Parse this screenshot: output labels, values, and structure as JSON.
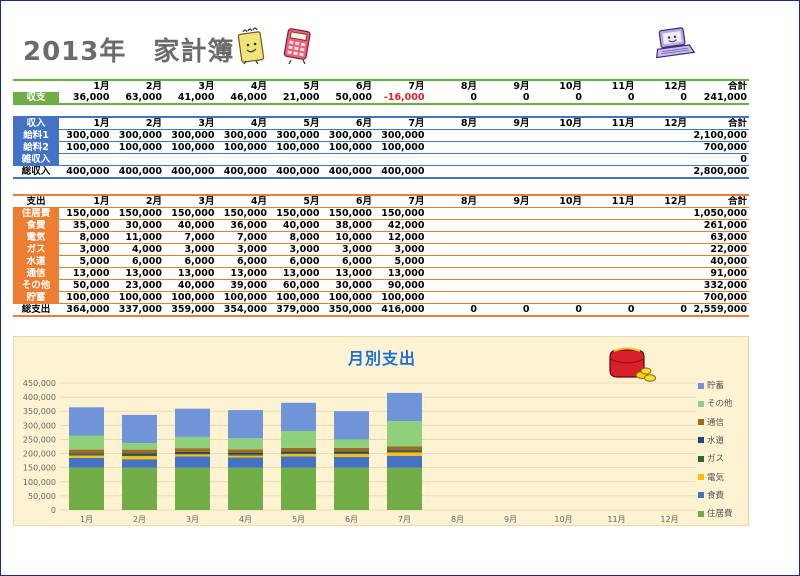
{
  "title": "2013年　家計簿",
  "months": [
    "1月",
    "2月",
    "3月",
    "4月",
    "5月",
    "6月",
    "7月",
    "8月",
    "9月",
    "10月",
    "11月",
    "12月"
  ],
  "total_label": "合計",
  "balance": {
    "label": "収支",
    "values": [
      "36,000",
      "63,000",
      "41,000",
      "46,000",
      "21,000",
      "50,000",
      "-16,000",
      "0",
      "0",
      "0",
      "0",
      "0"
    ],
    "total": "241,000"
  },
  "income": {
    "header": "収入",
    "rows": [
      {
        "label": "給料1",
        "values": [
          "300,000",
          "300,000",
          "300,000",
          "300,000",
          "300,000",
          "300,000",
          "300,000",
          "",
          "",
          "",
          "",
          ""
        ],
        "total": "2,100,000"
      },
      {
        "label": "給料2",
        "values": [
          "100,000",
          "100,000",
          "100,000",
          "100,000",
          "100,000",
          "100,000",
          "100,000",
          "",
          "",
          "",
          "",
          ""
        ],
        "total": "700,000"
      },
      {
        "label": "雑収入",
        "values": [
          "",
          "",
          "",
          "",
          "",
          "",
          "",
          "",
          "",
          "",
          "",
          ""
        ],
        "total": "0"
      }
    ],
    "sum": {
      "label": "総収入",
      "values": [
        "400,000",
        "400,000",
        "400,000",
        "400,000",
        "400,000",
        "400,000",
        "400,000",
        "",
        "",
        "",
        "",
        ""
      ],
      "total": "2,800,000"
    }
  },
  "expense": {
    "header": "支出",
    "rows": [
      {
        "label": "住居費",
        "values": [
          "150,000",
          "150,000",
          "150,000",
          "150,000",
          "150,000",
          "150,000",
          "150,000",
          "",
          "",
          "",
          "",
          ""
        ],
        "total": "1,050,000"
      },
      {
        "label": "食費",
        "values": [
          "35,000",
          "30,000",
          "40,000",
          "36,000",
          "40,000",
          "38,000",
          "42,000",
          "",
          "",
          "",
          "",
          ""
        ],
        "total": "261,000"
      },
      {
        "label": "電気",
        "values": [
          "8,000",
          "11,000",
          "7,000",
          "7,000",
          "8,000",
          "10,000",
          "12,000",
          "",
          "",
          "",
          "",
          ""
        ],
        "total": "63,000"
      },
      {
        "label": "ガス",
        "values": [
          "3,000",
          "4,000",
          "3,000",
          "3,000",
          "3,000",
          "3,000",
          "3,000",
          "",
          "",
          "",
          "",
          ""
        ],
        "total": "22,000"
      },
      {
        "label": "水道",
        "values": [
          "5,000",
          "6,000",
          "6,000",
          "6,000",
          "6,000",
          "6,000",
          "5,000",
          "",
          "",
          "",
          "",
          ""
        ],
        "total": "40,000"
      },
      {
        "label": "通信",
        "values": [
          "13,000",
          "13,000",
          "13,000",
          "13,000",
          "13,000",
          "13,000",
          "13,000",
          "",
          "",
          "",
          "",
          ""
        ],
        "total": "91,000"
      },
      {
        "label": "その他",
        "values": [
          "50,000",
          "23,000",
          "40,000",
          "39,000",
          "60,000",
          "30,000",
          "90,000",
          "",
          "",
          "",
          "",
          ""
        ],
        "total": "332,000"
      },
      {
        "label": "貯蓄",
        "values": [
          "100,000",
          "100,000",
          "100,000",
          "100,000",
          "100,000",
          "100,000",
          "100,000",
          "",
          "",
          "",
          "",
          ""
        ],
        "total": "700,000"
      }
    ],
    "sum": {
      "label": "総支出",
      "values": [
        "364,000",
        "337,000",
        "359,000",
        "354,000",
        "379,000",
        "350,000",
        "416,000",
        "0",
        "0",
        "0",
        "0",
        "0"
      ],
      "total": "2,559,000"
    }
  },
  "icons": {
    "notepad": "notepad-icon",
    "calculator": "calculator-icon",
    "laptop": "laptop-icon",
    "wallet": "wallet-coins-icon"
  },
  "chart_data": {
    "type": "bar",
    "stacked": true,
    "title": "月別支出",
    "categories": [
      "1月",
      "2月",
      "3月",
      "4月",
      "5月",
      "6月",
      "7月",
      "8月",
      "9月",
      "10月",
      "11月",
      "12月"
    ],
    "ylim": [
      0,
      450000
    ],
    "yticks": [
      "0",
      "50,000",
      "100,000",
      "150,000",
      "200,000",
      "250,000",
      "300,000",
      "350,000",
      "400,000",
      "450,000"
    ],
    "grid": true,
    "legend_position": "right",
    "series": [
      {
        "name": "住居費",
        "color": "#70ad47",
        "values": [
          150000,
          150000,
          150000,
          150000,
          150000,
          150000,
          150000,
          0,
          0,
          0,
          0,
          0
        ]
      },
      {
        "name": "食費",
        "color": "#4472c4",
        "values": [
          35000,
          30000,
          40000,
          36000,
          40000,
          38000,
          42000,
          0,
          0,
          0,
          0,
          0
        ]
      },
      {
        "name": "電気",
        "color": "#ffc000",
        "values": [
          8000,
          11000,
          7000,
          7000,
          8000,
          10000,
          12000,
          0,
          0,
          0,
          0,
          0
        ]
      },
      {
        "name": "ガス",
        "color": "#2e6b2e",
        "values": [
          3000,
          4000,
          3000,
          3000,
          3000,
          3000,
          3000,
          0,
          0,
          0,
          0,
          0
        ]
      },
      {
        "name": "水道",
        "color": "#264478",
        "values": [
          5000,
          6000,
          6000,
          6000,
          6000,
          6000,
          5000,
          0,
          0,
          0,
          0,
          0
        ]
      },
      {
        "name": "通信",
        "color": "#9e6a1e",
        "values": [
          13000,
          13000,
          13000,
          13000,
          13000,
          13000,
          13000,
          0,
          0,
          0,
          0,
          0
        ]
      },
      {
        "name": "その他",
        "color": "#8fd07a",
        "values": [
          50000,
          23000,
          40000,
          39000,
          60000,
          30000,
          90000,
          0,
          0,
          0,
          0,
          0
        ]
      },
      {
        "name": "貯蓄",
        "color": "#6f94d8",
        "values": [
          100000,
          100000,
          100000,
          100000,
          100000,
          100000,
          100000,
          0,
          0,
          0,
          0,
          0
        ]
      }
    ]
  }
}
